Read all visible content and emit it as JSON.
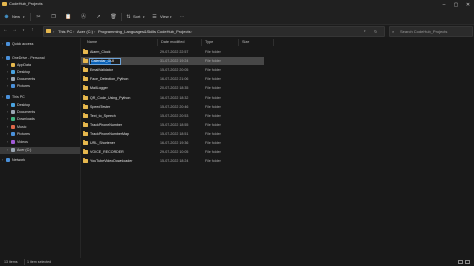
{
  "window": {
    "title": "CodeHub_Projects"
  },
  "toolbar": {
    "new_label": "New",
    "sort_label": "Sort",
    "view_label": "View",
    "more_label": "···",
    "icons": [
      "cut-icon",
      "copy-icon",
      "paste-icon",
      "rename-icon",
      "share-icon",
      "delete-icon"
    ]
  },
  "address": {
    "crumbs": [
      "This PC",
      "Acer (C:)",
      "Programming_Languages&Skills",
      "CodeHub_Projects"
    ],
    "search_placeholder": "Search CodeHub_Projects"
  },
  "sidebar": {
    "items": [
      {
        "label": "Quick access",
        "icon": "star-icon",
        "color": "#4a90d9",
        "indent": 0,
        "chev": true
      },
      {
        "label": "OneDrive - Personal",
        "icon": "cloud-icon",
        "color": "#4a90d9",
        "indent": 0,
        "chev": true
      },
      {
        "label": "AppData",
        "icon": "folder-icon",
        "color": "#e6b84e",
        "indent": 1,
        "chev": true
      },
      {
        "label": "Desktop",
        "icon": "desktop-icon",
        "color": "#4aa3e0",
        "indent": 1,
        "chev": true
      },
      {
        "label": "Documents",
        "icon": "documents-icon",
        "color": "#9aa6b2",
        "indent": 1,
        "chev": true
      },
      {
        "label": "Pictures",
        "icon": "pictures-icon",
        "color": "#4a90d9",
        "indent": 1,
        "chev": true
      },
      {
        "label": "This PC",
        "icon": "computer-icon",
        "color": "#4a90d9",
        "indent": 0,
        "chev": true
      },
      {
        "label": "Desktop",
        "icon": "desktop-icon",
        "color": "#4aa3e0",
        "indent": 1,
        "chev": true
      },
      {
        "label": "Documents",
        "icon": "documents-icon",
        "color": "#9aa6b2",
        "indent": 1,
        "chev": true
      },
      {
        "label": "Downloads",
        "icon": "downloads-icon",
        "color": "#3fb37f",
        "indent": 1,
        "chev": true
      },
      {
        "label": "Music",
        "icon": "music-icon",
        "color": "#e0684a",
        "indent": 1,
        "chev": true
      },
      {
        "label": "Pictures",
        "icon": "pictures-icon",
        "color": "#4a90d9",
        "indent": 1,
        "chev": true
      },
      {
        "label": "Videos",
        "icon": "videos-icon",
        "color": "#a05ad6",
        "indent": 1,
        "chev": true
      },
      {
        "label": "Acer (C:)",
        "icon": "drive-icon",
        "color": "#9aa6b2",
        "indent": 1,
        "chev": true,
        "selected": true
      },
      {
        "label": "Network",
        "icon": "network-icon",
        "color": "#4a90d9",
        "indent": 0,
        "chev": true
      }
    ]
  },
  "columns": {
    "name": "Name",
    "date": "Date modified",
    "type": "Type",
    "size": "Size"
  },
  "files": [
    {
      "name": "Alarm_Clock",
      "date": "29-07-2022 22:57",
      "type": "File folder"
    },
    {
      "name": "Calendar_GUI",
      "date": "31-07-2022 19:24",
      "type": "File folder",
      "selected": true,
      "renaming": true
    },
    {
      "name": "EmailValidator",
      "date": "15-07-2022 20:05",
      "type": "File folder"
    },
    {
      "name": "Face_Detection_Python",
      "date": "16-07-2022 21:06",
      "type": "File folder"
    },
    {
      "name": "MailLogger",
      "date": "20-07-2022 18:35",
      "type": "File folder"
    },
    {
      "name": "QR_Code_Using_Python",
      "date": "16-07-2022 18:32",
      "type": "File folder"
    },
    {
      "name": "SpeedTester",
      "date": "15-07-2022 20:46",
      "type": "File folder"
    },
    {
      "name": "Text_to_Speech",
      "date": "15-07-2022 20:53",
      "type": "File folder"
    },
    {
      "name": "TrackPhoneNumber",
      "date": "15-07-2022 18:55",
      "type": "File folder"
    },
    {
      "name": "TrackPhoneNumberMap",
      "date": "15-07-2022 18:51",
      "type": "File folder"
    },
    {
      "name": "URL_Shortener",
      "date": "16-07-2022 19:36",
      "type": "File folder"
    },
    {
      "name": "VOICE_RECORDER",
      "date": "29-07-2022 10:05",
      "type": "File folder"
    },
    {
      "name": "YouTubeVideoDownloader",
      "date": "15-07-2022 18:24",
      "type": "File folder"
    }
  ],
  "status": {
    "items_count": "13 items",
    "selected_count": "1 item selected"
  },
  "colors": {
    "accent": "#0a62b8",
    "folder": "#e6b84e",
    "background": "#191919"
  }
}
